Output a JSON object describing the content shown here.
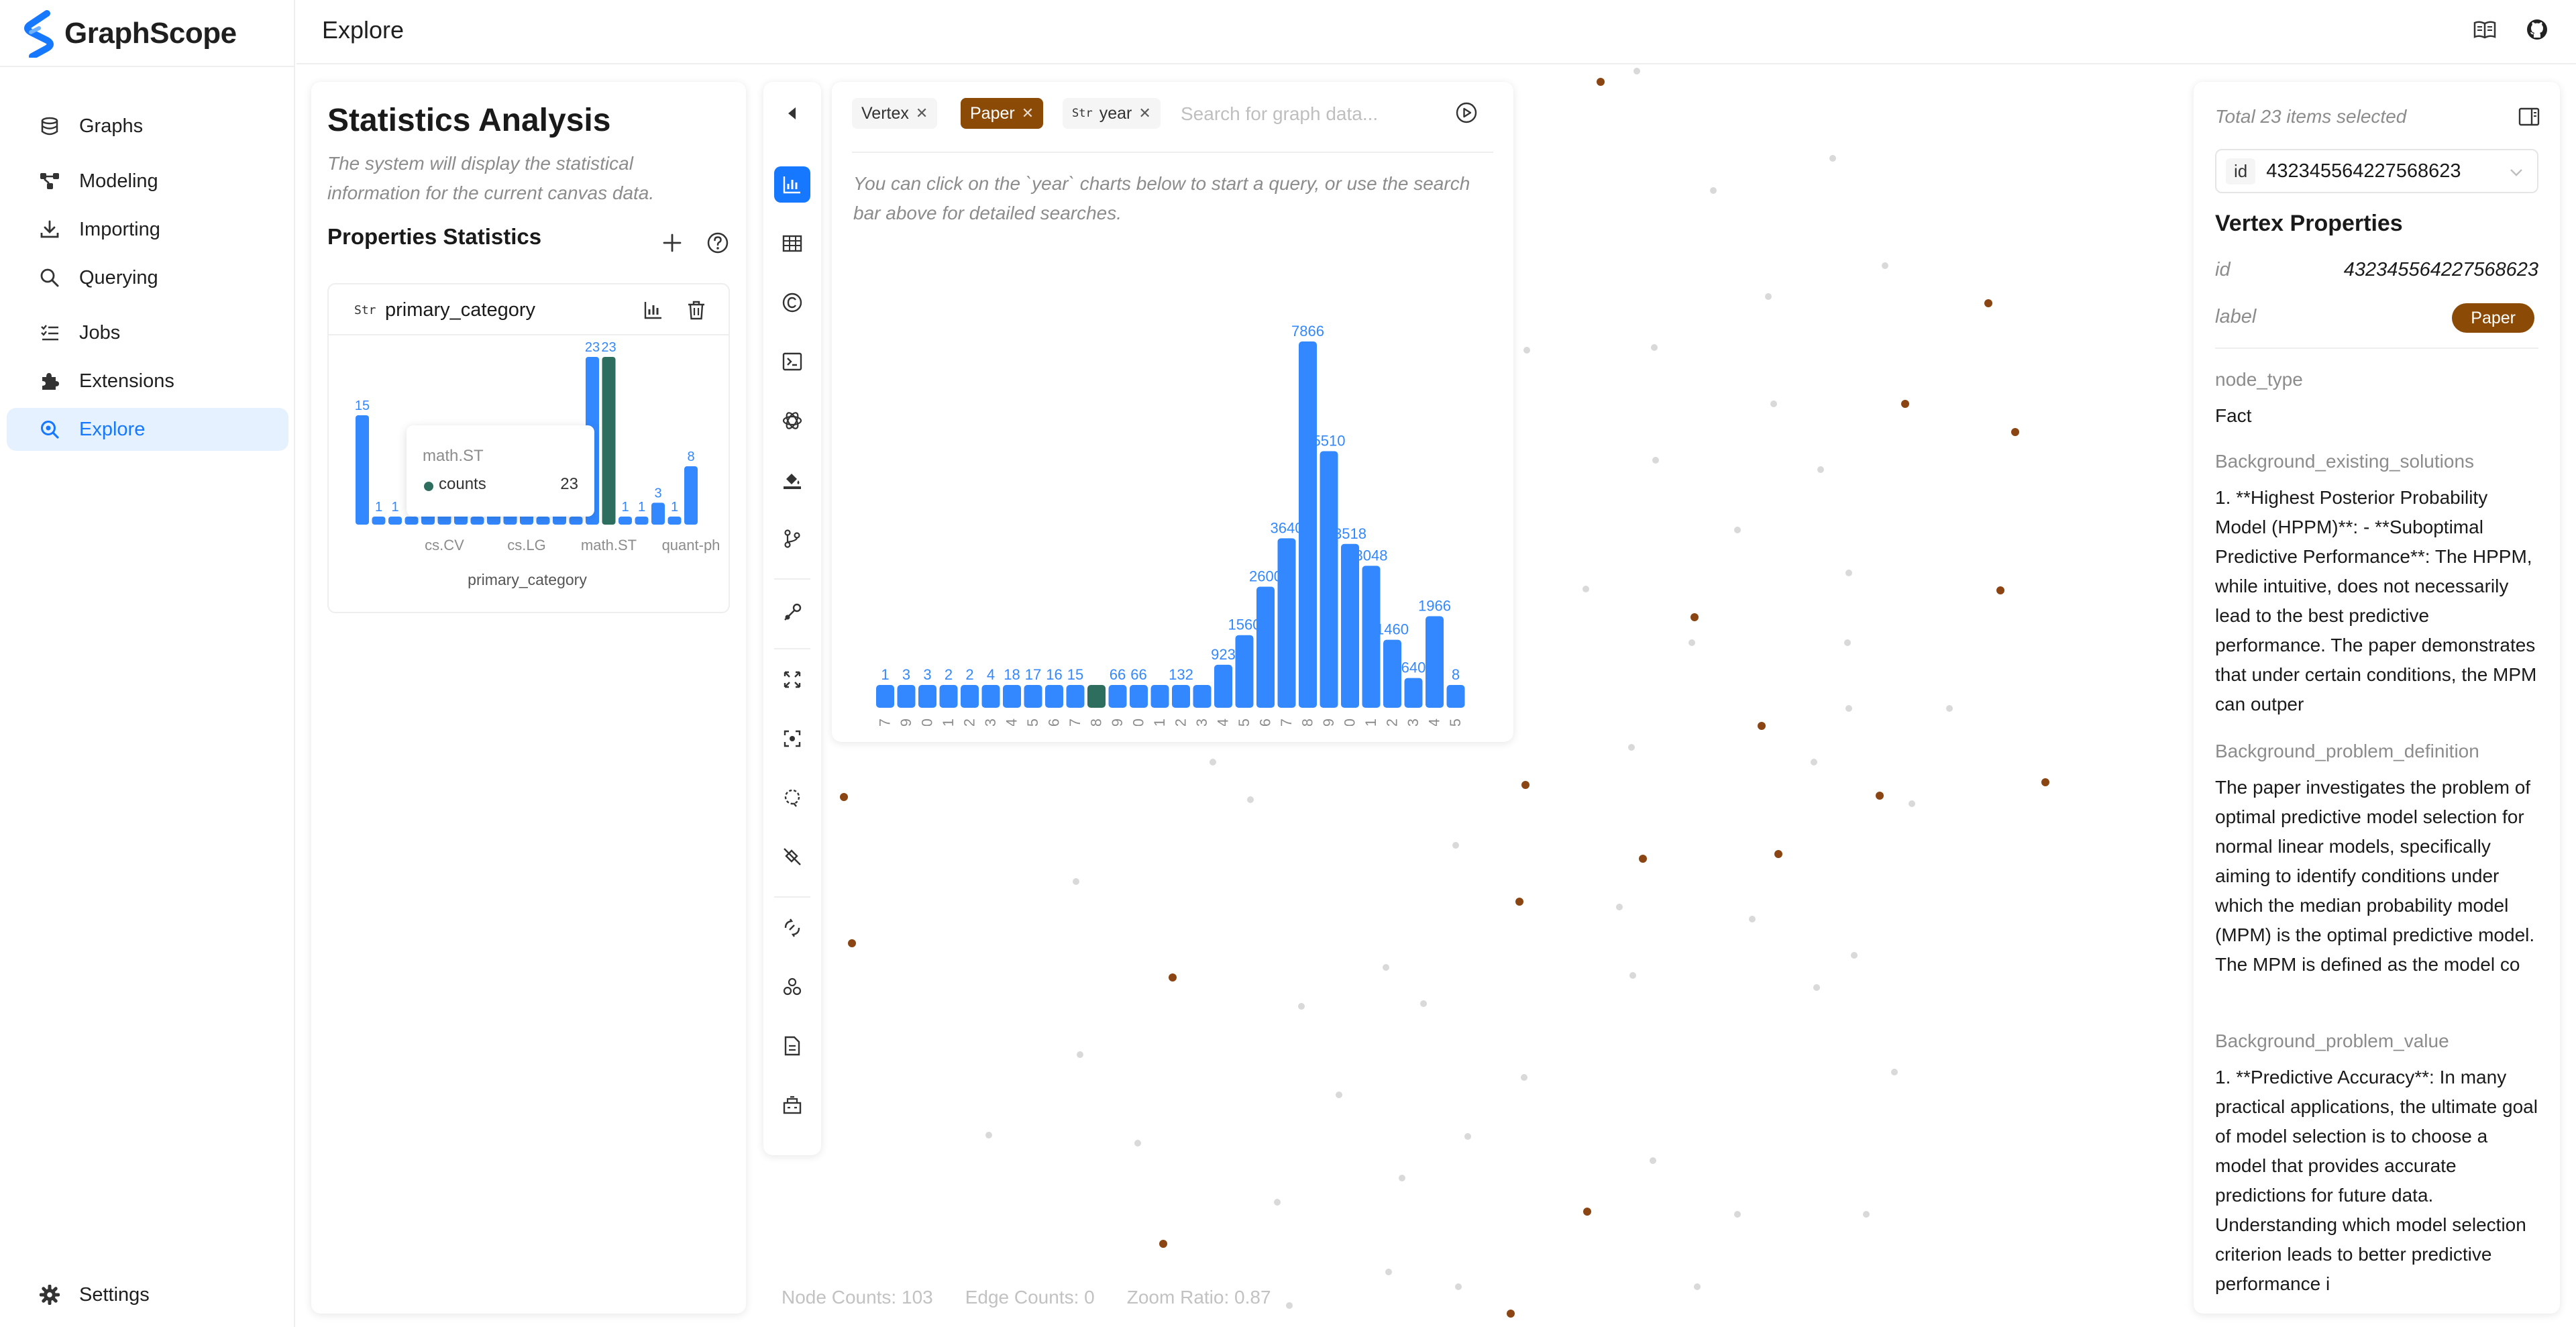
{
  "app": {
    "name": "GraphScope",
    "brand_color": "#1677ff",
    "accent_brown": "#8b4a06"
  },
  "sidebar": {
    "items": [
      {
        "label": "Graphs",
        "icon": "database-icon"
      },
      {
        "label": "Modeling",
        "icon": "modeling-icon"
      },
      {
        "label": "Importing",
        "icon": "download-icon"
      },
      {
        "label": "Querying",
        "icon": "search-icon"
      },
      {
        "label": "Jobs",
        "icon": "list-icon"
      },
      {
        "label": "Extensions",
        "icon": "puzzle-icon"
      },
      {
        "label": "Explore",
        "icon": "explore-icon",
        "active": true
      }
    ],
    "settings_label": "Settings"
  },
  "header": {
    "title": "Explore"
  },
  "stats": {
    "title": "Statistics Analysis",
    "description": "The system will display the statistical information for the current canvas data.",
    "properties_title": "Properties Statistics",
    "card": {
      "type_tag": "Str",
      "property": "primary_category",
      "tooltip": {
        "title": "math.ST",
        "series": "counts",
        "value": "23"
      }
    }
  },
  "query": {
    "chips": {
      "vertex": "Vertex",
      "paper": "Paper",
      "year_tag": "Str",
      "year": "year"
    },
    "search_placeholder": "Search for graph data...",
    "hint": "You can click on the `year` charts below to start a query, or use the search bar above for detailed searches."
  },
  "details": {
    "total": "Total 23 items selected",
    "id_tag": "id",
    "id_value": "432345564227568623",
    "vertex_title": "Vertex Properties",
    "id_key": "id",
    "id_val": "432345564227568623",
    "label_key": "label",
    "label_val": "Paper",
    "props": [
      {
        "key": "node_type",
        "value": "Fact"
      },
      {
        "key": "Background_existing_solutions",
        "value": "1. **Highest Posterior Probability Model (HPPM)**: - **Suboptimal Predictive Performance**: The HPPM, while intuitive, does not necessarily lead to the best predictive performance. The paper demonstrates that under certain conditions, the MPM can outper"
      },
      {
        "key": "Background_problem_definition",
        "value": "The paper investigates the problem of optimal predictive model selection for normal linear models, specifically aiming to identify conditions under which the median probability model (MPM) is the optimal predictive model. The MPM is defined as the model co"
      },
      {
        "key": "Background_problem_value",
        "value": "1. **Predictive Accuracy**: In many practical applications, the ultimate goal of model selection is to choose a model that provides accurate predictions for future data. Understanding which model selection criterion leads to better predictive performance i"
      }
    ]
  },
  "canvas": {
    "node_counts": "Node Counts: 103",
    "edge_counts": "Edge Counts: 0",
    "zoom_ratio": "Zoom Ratio: 0.87",
    "node_colors": {
      "selected": "#8b4513",
      "unselected": "#d9d9d9"
    }
  },
  "chart_data": [
    {
      "type": "bar",
      "title": "",
      "xlabel": "primary_category",
      "ylabel": "",
      "series": [
        {
          "name": "counts",
          "values": [
            15,
            1,
            1,
            1,
            9,
            3,
            4,
            1,
            2,
            2,
            7,
            1,
            2,
            1,
            23,
            23,
            1,
            1,
            3,
            1,
            8
          ]
        }
      ],
      "categories_visible": [
        "cs.CV",
        "cs.LG",
        "math.ST",
        "quant-ph"
      ],
      "highlight_index": 15,
      "colors": {
        "bar": "#3388ff",
        "highlight": "#2e6e5e"
      }
    },
    {
      "type": "bar",
      "title": "",
      "xlabel": "year",
      "ylabel": "",
      "categories": [
        "1997",
        "1999",
        "2000",
        "2001",
        "2002",
        "2003",
        "2004",
        "2005",
        "2006",
        "2007",
        "2008",
        "2009",
        "2010",
        "2011",
        "2012",
        "2013",
        "2014",
        "2015",
        "2016",
        "2017",
        "2018",
        "2019",
        "2020",
        "2021",
        "2022",
        "2023",
        "2024",
        "2025"
      ],
      "series": [
        {
          "name": "counts",
          "values": [
            1,
            3,
            3,
            2,
            2,
            4,
            18,
            17,
            16,
            15,
            40,
            66,
            66,
            90,
            132,
            400,
            923,
            1560,
            2600,
            3640,
            7866,
            5510,
            3518,
            3048,
            1460,
            640,
            1966,
            8
          ]
        }
      ],
      "labels": [
        "1",
        "3",
        "3",
        "2",
        "2",
        "4",
        "18",
        "17",
        "16",
        "15",
        "",
        "66",
        "66",
        "",
        "132",
        "",
        "923",
        "1560",
        "2600",
        "3640",
        "7866",
        "5510",
        "3518",
        "3048",
        "1460",
        "640",
        "1966",
        "8"
      ],
      "highlight_index": 10,
      "colors": {
        "bar": "#3388ff",
        "highlight": "#2e6e5e"
      }
    }
  ]
}
